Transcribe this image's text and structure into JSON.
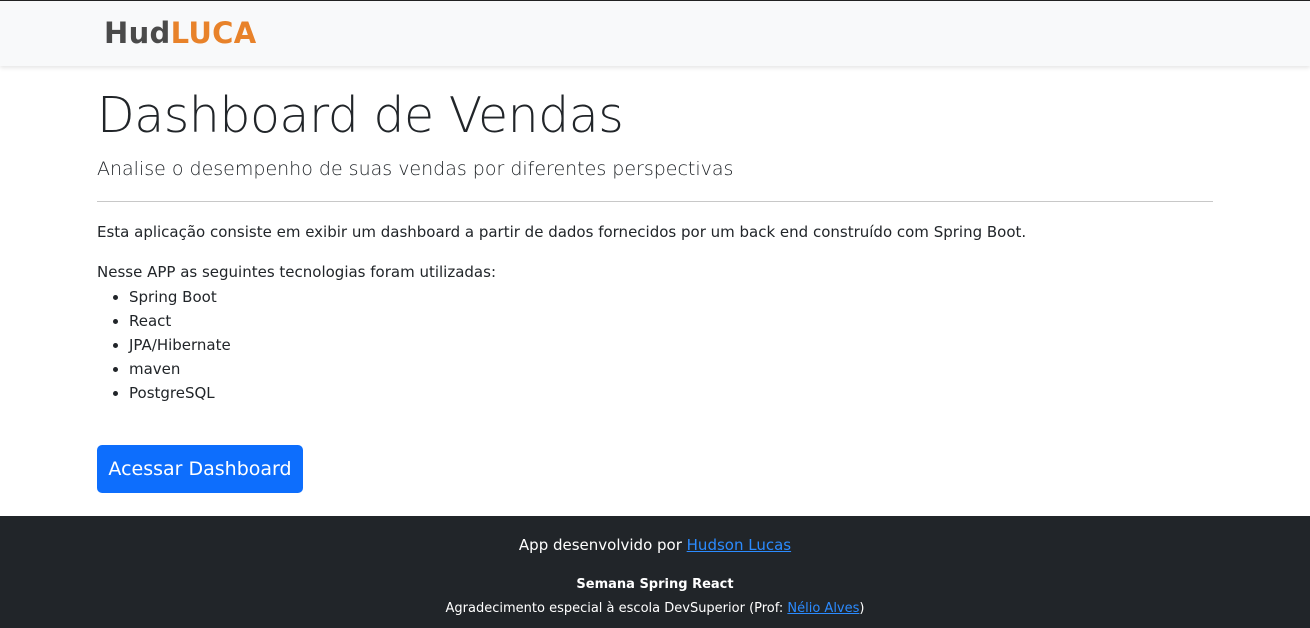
{
  "header": {
    "brand_part1": "Hud",
    "brand_part2": "LUCA"
  },
  "main": {
    "title": "Dashboard de Vendas",
    "subtitle": "Analise o desempenho de suas vendas por diferentes perspectivas",
    "description": "Esta aplicação consiste em exibir um dashboard a partir de dados fornecidos por um back end construído com Spring Boot.",
    "tech_intro": "Nesse APP as seguintes tecnologias foram utilizadas:",
    "technologies": [
      "Spring Boot",
      "React",
      "JPA/Hibernate",
      "maven",
      "PostgreSQL"
    ],
    "cta_label": "Acessar Dashboard"
  },
  "footer": {
    "line1_prefix": "App desenvolvido por ",
    "line1_link": "Hudson Lucas",
    "line2": "Semana Spring React",
    "line3_prefix": "Agradecimento especial à escola DevSuperior (Prof: ",
    "line3_link": "Nélio Alves",
    "line3_suffix": ")"
  },
  "colors": {
    "brand_dark": "#4a4a4a",
    "brand_accent": "#e8822a",
    "primary_button": "#0d6efd",
    "footer_bg": "#212529",
    "link": "#2b8bff"
  }
}
